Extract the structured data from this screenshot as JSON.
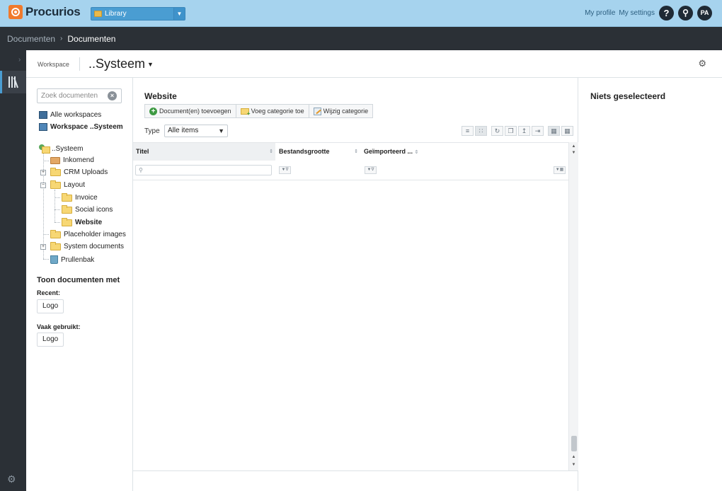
{
  "app": {
    "name": "Procurios",
    "library_select": "Library",
    "top_links": [
      "My profile",
      "My settings"
    ],
    "help_label": "?",
    "avatar_initials": "PA"
  },
  "breadcrumb": [
    "Documenten",
    "Documenten"
  ],
  "workspace": {
    "label": "Workspace",
    "title": "..Systeem"
  },
  "tree": {
    "search_placeholder": "Zoek documenten",
    "workspaces": [
      "Alle workspaces",
      "Workspace ..Systeem"
    ],
    "root": "..Systeem",
    "items": [
      "Inkomend",
      "CRM Uploads",
      "Layout",
      "Invoice",
      "Social icons",
      "Website",
      "Placeholder images",
      "System documents",
      "Prullenbak"
    ]
  },
  "recent_section": {
    "title": "Toon documenten met la",
    "recent_label": "Recent:",
    "recent_item": "Logo",
    "frequent_label": "Vaak gebruikt:",
    "frequent_item": "Logo"
  },
  "center": {
    "title": "Website",
    "buttons": [
      "Document(en) toevoegen",
      "Voeg categorie toe",
      "Wijzig categorie"
    ],
    "type_label": "Type",
    "type_value": "Alle items",
    "columns": [
      "Titel",
      "Bestandsgrootte",
      "Geïmporteerd ..."
    ]
  },
  "right": {
    "title": "Niets geselecteerd"
  },
  "icons": {
    "accent_blue": "#4a9dd2",
    "brand_orange": "#f07a2c",
    "dark_bar": "#2b3036"
  }
}
